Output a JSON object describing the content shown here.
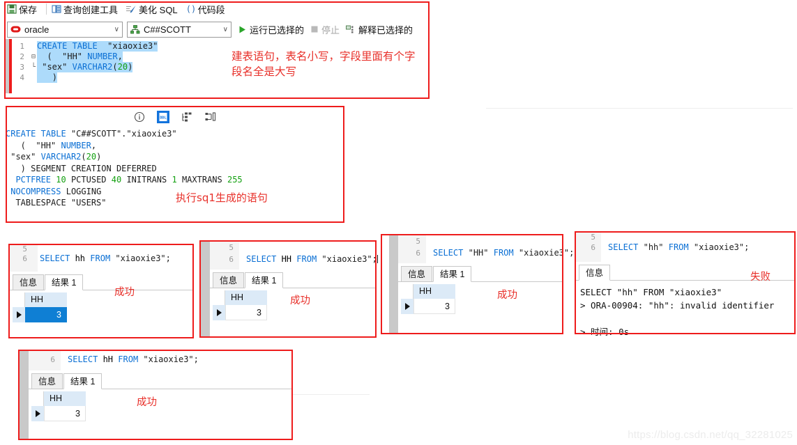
{
  "toolbar": {
    "menu": [
      {
        "label": "保存",
        "icon": "save-icon"
      },
      {
        "label": "查询创建工具",
        "icon": "query-builder-icon"
      },
      {
        "label": "美化 SQL",
        "icon": "beautify-sql-icon"
      },
      {
        "label": "代码段",
        "icon": "code-snippet-icon"
      }
    ],
    "db_combo": {
      "value": "oracle",
      "icon": "oracle-icon",
      "caret": "∨"
    },
    "schema_combo": {
      "value": "C##SCOTT",
      "icon": "schema-icon",
      "caret": "∨"
    },
    "run_selected": {
      "label": "运行已选择的",
      "icon": "play-icon"
    },
    "stop": {
      "label": "停止",
      "icon": "stop-icon"
    },
    "explain_selected": {
      "label": "解释已选择的",
      "icon": "explain-icon"
    }
  },
  "editor": {
    "lines": [
      {
        "num": "1",
        "fold": "",
        "text": "CREATE TABLE  \"xiaoxie3\""
      },
      {
        "num": "2",
        "fold": "⊟",
        "text": "  (  \"HH\" NUMBER,"
      },
      {
        "num": "3",
        "fold": "└",
        "text": " \"sex\" VARCHAR2(20)"
      },
      {
        "num": "4",
        "fold": "",
        "text": "   )"
      }
    ],
    "annotation": "建表语句，表名小写，字段里面有个字\n段名全是大写"
  },
  "ddl_panel": {
    "icons": [
      {
        "name": "info-icon",
        "glyph": "ⓘ",
        "active": false
      },
      {
        "name": "ddl-icon",
        "glyph": "DDL",
        "active": true
      },
      {
        "name": "dependency-icon",
        "glyph": "",
        "active": false
      },
      {
        "name": "structure-icon",
        "glyph": "",
        "active": false
      }
    ],
    "lines": [
      "CREATE TABLE \"C##SCOTT\".\"xiaoxie3\"",
      "   (  \"HH\" NUMBER,",
      " \"sex\" VARCHAR2(20)",
      "   ) SEGMENT CREATION DEFERRED",
      "  PCTFREE 10 PCTUSED 40 INITRANS 1 MAXTRANS 255",
      " NOCOMPRESS LOGGING",
      "  TABLESPACE \"USERS\""
    ],
    "annotation": "执行sq1生成的语句"
  },
  "results": [
    {
      "id": "result-hh-lower",
      "sql_lines": [
        {
          "num": "5",
          "text": ""
        },
        {
          "num": "6",
          "text": "SELECT hh FROM \"xiaoxie3\";"
        }
      ],
      "tabs": [
        {
          "label": "信息",
          "active": false
        },
        {
          "label": "结果 1",
          "active": true
        }
      ],
      "column": "HH",
      "value": "3",
      "value_selected": true,
      "header_highlight": true,
      "annotation": "成功"
    },
    {
      "id": "result-hh-upper",
      "sql_lines": [
        {
          "num": "5",
          "text": ""
        },
        {
          "num": "6",
          "text": "SELECT HH FROM \"xiaoxie3\";"
        }
      ],
      "tabs": [
        {
          "label": "信息",
          "active": false
        },
        {
          "label": "结果 1",
          "active": true
        }
      ],
      "column": "HH",
      "value": "3",
      "value_selected": false,
      "header_highlight": true,
      "annotation": "成功"
    },
    {
      "id": "result-hh-quoted-upper",
      "sql_lines": [
        {
          "num": "5",
          "text": ""
        },
        {
          "num": "6",
          "text": "SELECT \"HH\" FROM \"xiaoxie3\";"
        }
      ],
      "tabs": [
        {
          "label": "信息",
          "active": false
        },
        {
          "label": "结果 1",
          "active": true
        }
      ],
      "column": "HH",
      "value": "3",
      "value_selected": false,
      "header_highlight": true,
      "annotation": "成功"
    },
    {
      "id": "result-hh-mixed",
      "sql_lines": [
        {
          "num": "6",
          "text": "SELECT hH FROM \"xiaoxie3\";"
        }
      ],
      "tabs": [
        {
          "label": "信息",
          "active": false
        },
        {
          "label": "结果 1",
          "active": true
        }
      ],
      "column": "HH",
      "value": "3",
      "value_selected": false,
      "header_highlight": true,
      "annotation": "成功"
    }
  ],
  "error_panel": {
    "id": "result-hh-quoted-lower",
    "sql_lines": [
      {
        "num": "5",
        "text": ""
      },
      {
        "num": "6",
        "text": "SELECT \"hh\" FROM \"xiaoxie3\";"
      }
    ],
    "tabs": [
      {
        "label": "信息",
        "active": true
      }
    ],
    "message": "SELECT \"hh\" FROM \"xiaoxie3\"\n> ORA-00904: \"hh\": invalid identifier\n\n> 时间: 0s",
    "annotation": "失败"
  },
  "watermark": "https://blog.csdn.net/qq_32281025",
  "colors": {
    "annotation_red": "#e8302a",
    "box_red": "#ee1c1c",
    "keyword_blue": "#0a6fd4",
    "number_green": "#13a010",
    "selection_blue": "#addbfb",
    "grid_selected": "#0f7fd4",
    "grid_header": "#dceaf7"
  }
}
